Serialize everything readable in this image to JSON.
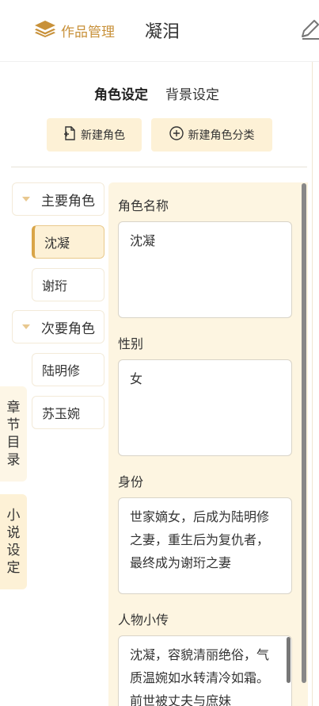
{
  "header": {
    "works_mgmt_label": "作品管理",
    "novel_title": "凝泪",
    "icons": {
      "layers": "layers-icon",
      "edit": "edit-pencil-icon"
    },
    "accent_color": "#c8913a"
  },
  "tabs": [
    {
      "label": "角色设定",
      "active": true
    },
    {
      "label": "背景设定",
      "active": false
    }
  ],
  "actions": {
    "new_role_label": "新建角色",
    "new_category_label": "新建角色分类"
  },
  "role_tree": {
    "categories": [
      {
        "label": "主要角色",
        "roles": [
          "沈凝",
          "谢珩"
        ]
      },
      {
        "label": "次要角色",
        "roles": [
          "陆明修",
          "苏玉婉"
        ]
      }
    ],
    "selected_role": "沈凝"
  },
  "side_tabs": {
    "toc_label": "章节目录",
    "settings_label": "小说设定"
  },
  "form": {
    "name_label": "角色名称",
    "name_value": "沈凝",
    "gender_label": "性别",
    "gender_value": "女",
    "identity_label": "身份",
    "identity_value": "世家嫡女，后成为陆明修之妻，重生后为复仇者，最终成为谢珩之妻",
    "bio_label": "人物小传",
    "bio_value": "沈凝，容貌清丽绝俗，气质温婉如水转清冷如霜。前世被丈夫与庶妹"
  }
}
